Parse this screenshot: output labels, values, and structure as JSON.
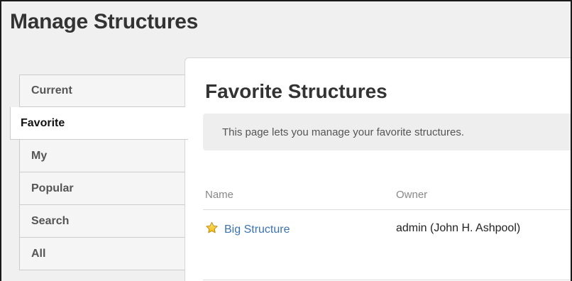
{
  "page": {
    "title": "Manage Structures"
  },
  "tabs": [
    {
      "label": "Current",
      "active": false
    },
    {
      "label": "Favorite",
      "active": true
    },
    {
      "label": "My",
      "active": false
    },
    {
      "label": "Popular",
      "active": false
    },
    {
      "label": "Search",
      "active": false
    },
    {
      "label": "All",
      "active": false
    }
  ],
  "panel": {
    "title": "Favorite Structures",
    "info": "This page lets you manage your favorite structures.",
    "columns": {
      "name": "Name",
      "owner": "Owner"
    },
    "rows": [
      {
        "icon": "star-icon",
        "name": "Big Structure",
        "owner": "admin (John H. Ashpool)"
      }
    ]
  },
  "colors": {
    "link": "#3b73af",
    "star": "#f5c518",
    "frame_background": "#f0f0f0"
  }
}
